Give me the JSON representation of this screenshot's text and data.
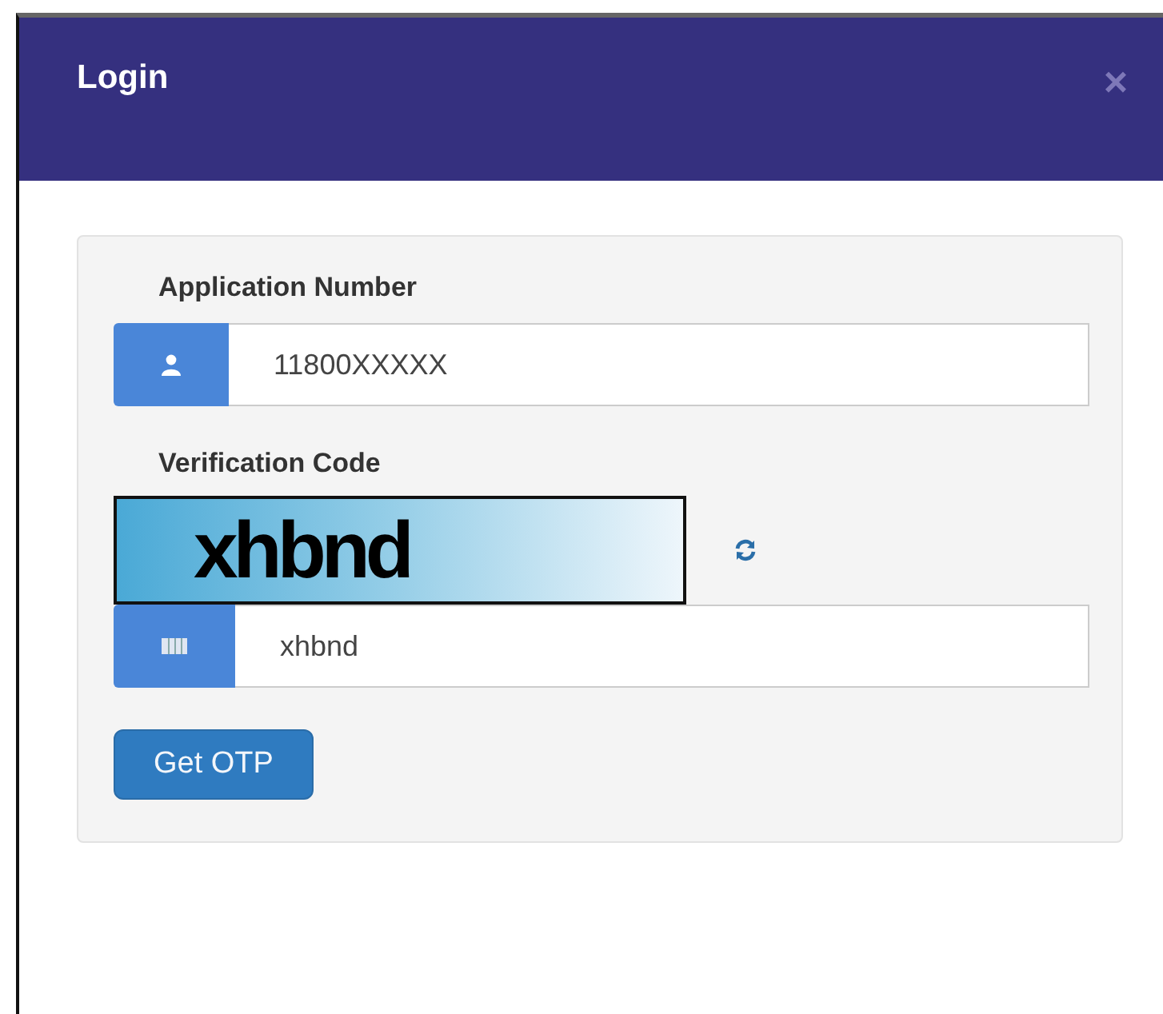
{
  "dialog": {
    "title": "Login",
    "close": "×"
  },
  "form": {
    "application_number": {
      "label": "Application Number",
      "value": "11800XXXXX"
    },
    "verification": {
      "label": "Verification Code",
      "captcha": "xhbnd",
      "value": "xhbnd"
    },
    "submit": "Get OTP"
  }
}
